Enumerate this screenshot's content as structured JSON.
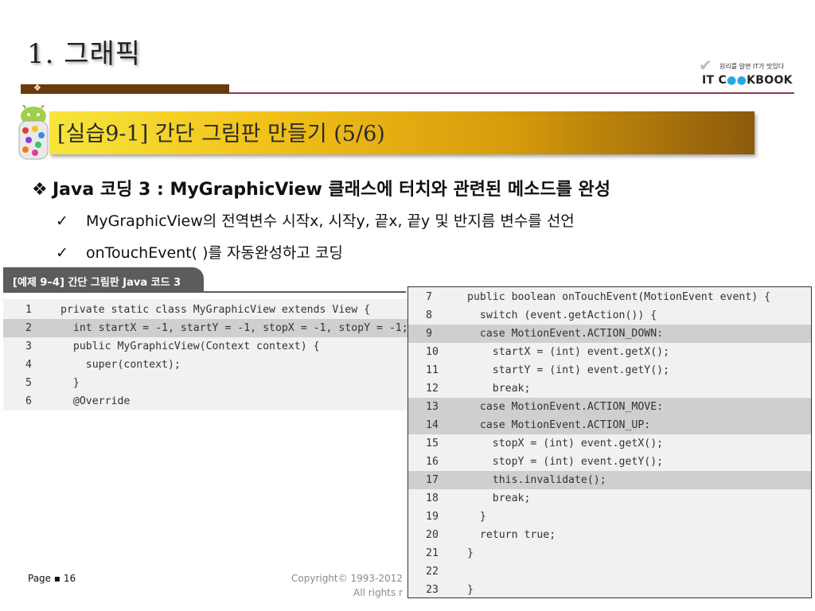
{
  "header": {
    "title": "1. 그래픽",
    "logo_tagline": "원리를 알면 IT가 맛있다",
    "logo_pre": "IT C",
    "logo_dots": "●●",
    "logo_post": "KBOOK"
  },
  "banner": {
    "text": "[실습9-1] 간단 그림판 만들기 (5/6)"
  },
  "bullets": {
    "main_marker": "❖",
    "main": "Java 코딩 3 : MyGraphicView 클래스에 터치와 관련된 메소드를 완성",
    "check_marker": "✓",
    "sub": [
      "MyGraphicView의 전역변수 시작x, 시작y, 끝x, 끝y 및 반지름 변수를 선언",
      "onTouchEvent( )를 자동완성하고 코딩"
    ]
  },
  "example_tab": "[예제 9–4] 간단 그림판 Java 코드 3",
  "code_left": [
    {
      "n": "1",
      "code": "private static class MyGraphicView extends View {",
      "hl": false
    },
    {
      "n": "2",
      "code": "  int startX = -1, startY = -1, stopX = -1, stopY = -1;",
      "hl": true
    },
    {
      "n": "3",
      "code": "  public MyGraphicView(Context context) {",
      "hl": false
    },
    {
      "n": "4",
      "code": "    super(context);",
      "hl": false
    },
    {
      "n": "5",
      "code": "  }",
      "hl": false
    },
    {
      "n": "6",
      "code": "  @Override",
      "hl": false
    }
  ],
  "code_right": [
    {
      "n": "7",
      "code": "public boolean onTouchEvent(MotionEvent event) {",
      "hl": false
    },
    {
      "n": "8",
      "code": "  switch (event.getAction()) {",
      "hl": false
    },
    {
      "n": "9",
      "code": "  case MotionEvent.ACTION_DOWN:",
      "hl": true
    },
    {
      "n": "10",
      "code": "    startX = (int) event.getX();",
      "hl": false
    },
    {
      "n": "11",
      "code": "    startY = (int) event.getY();",
      "hl": false
    },
    {
      "n": "12",
      "code": "    break;",
      "hl": false
    },
    {
      "n": "13",
      "code": "  case MotionEvent.ACTION_MOVE:",
      "hl": true
    },
    {
      "n": "14",
      "code": "  case MotionEvent.ACTION_UP:",
      "hl": true
    },
    {
      "n": "15",
      "code": "    stopX = (int) event.getX();",
      "hl": false
    },
    {
      "n": "16",
      "code": "    stopY = (int) event.getY();",
      "hl": false
    },
    {
      "n": "17",
      "code": "    this.invalidate();",
      "hl": true
    },
    {
      "n": "18",
      "code": "    break;",
      "hl": false
    },
    {
      "n": "19",
      "code": "  }",
      "hl": false
    },
    {
      "n": "20",
      "code": "  return true;",
      "hl": false
    },
    {
      "n": "21",
      "code": "}",
      "hl": false
    },
    {
      "n": "22",
      "code": "",
      "hl": false
    },
    {
      "n": "23",
      "code": "}",
      "hl": false
    }
  ],
  "footer": {
    "page": "Page ▪ 16",
    "copyright_line1": "Copyright© 1993-2012",
    "copyright_line2": "All rights r"
  }
}
